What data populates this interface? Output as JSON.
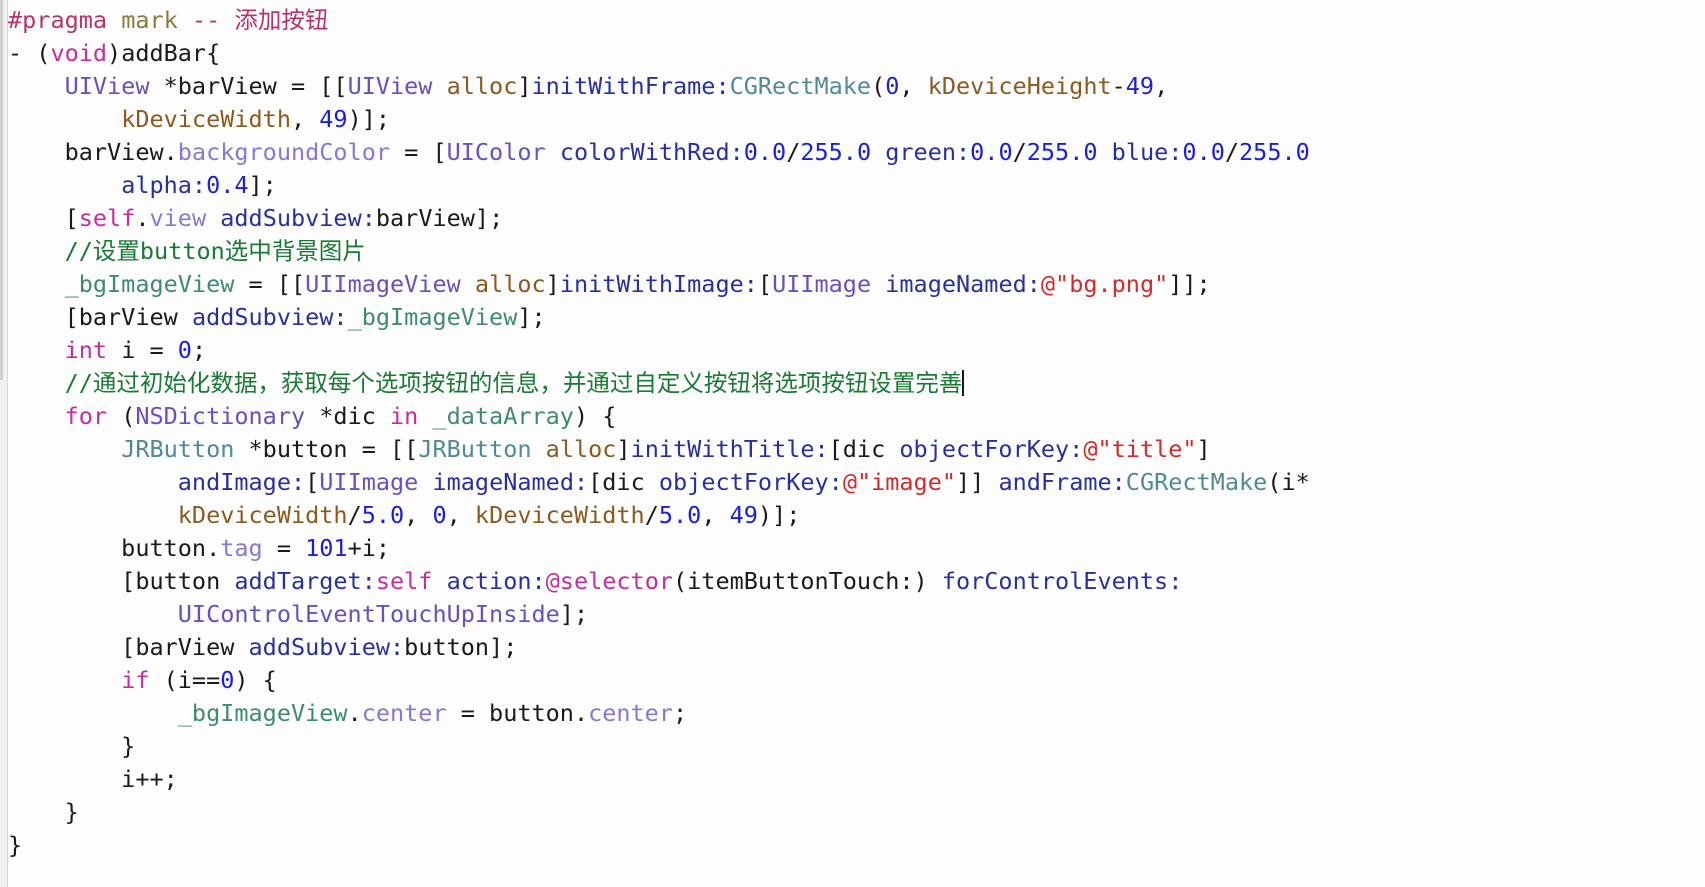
{
  "editor": {
    "language": "Objective-C",
    "background_color": "#ffffff",
    "gutter_color": "#f1f1f1",
    "font_size_px": 23.5,
    "caret_visible": true
  },
  "theme": {
    "plain": "#1a1a1a",
    "comment": "#1a7a35",
    "keyword": "#c42ea0",
    "class": "#6b4fbb",
    "custom_class": "#4f8a96",
    "property": "#8a78d0",
    "method": "#2a2f9e",
    "number": "#1d1ddb",
    "string": "#d12b2b",
    "constant": "#8a5a1e",
    "ivar": "#3f8a74",
    "preprocessor": "#b7336f"
  },
  "code_lines": [
    {
      "n": 1,
      "text": "#pragma mark -- 添加按钮",
      "tokens": [
        {
          "t": "#pragma",
          "c": "t-pre"
        },
        {
          "t": " ",
          "c": "t-plain"
        },
        {
          "t": "mark",
          "c": "t-preword"
        },
        {
          "t": " -- 添加按钮",
          "c": "t-pre"
        }
      ]
    },
    {
      "n": 2,
      "text": "- (void)addBar{",
      "tokens": [
        {
          "t": "- (",
          "c": "t-plain"
        },
        {
          "t": "void",
          "c": "t-keyword"
        },
        {
          "t": ")addBar{",
          "c": "t-plain"
        }
      ]
    },
    {
      "n": 3,
      "text": "    UIView *barView = [[UIView alloc]initWithFrame:CGRectMake(0, kDeviceHeight-49,",
      "tokens": [
        {
          "t": "    ",
          "c": "t-plain"
        },
        {
          "t": "UIView",
          "c": "t-class"
        },
        {
          "t": " *barView = [[",
          "c": "t-plain"
        },
        {
          "t": "UIView",
          "c": "t-class"
        },
        {
          "t": " ",
          "c": "t-plain"
        },
        {
          "t": "alloc",
          "c": "t-const"
        },
        {
          "t": "]",
          "c": "t-plain"
        },
        {
          "t": "initWithFrame:",
          "c": "t-method"
        },
        {
          "t": "CGRectMake",
          "c": "t-custom"
        },
        {
          "t": "(",
          "c": "t-plain"
        },
        {
          "t": "0",
          "c": "t-num"
        },
        {
          "t": ", ",
          "c": "t-plain"
        },
        {
          "t": "kDeviceHeight",
          "c": "t-const"
        },
        {
          "t": "-",
          "c": "t-plain"
        },
        {
          "t": "49",
          "c": "t-num"
        },
        {
          "t": ",",
          "c": "t-plain"
        }
      ]
    },
    {
      "n": 4,
      "text": "        kDeviceWidth, 49)];",
      "tokens": [
        {
          "t": "        ",
          "c": "t-plain"
        },
        {
          "t": "kDeviceWidth",
          "c": "t-const"
        },
        {
          "t": ", ",
          "c": "t-plain"
        },
        {
          "t": "49",
          "c": "t-num"
        },
        {
          "t": ")];",
          "c": "t-plain"
        }
      ]
    },
    {
      "n": 5,
      "text": "    barView.backgroundColor = [UIColor colorWithRed:0.0/255.0 green:0.0/255.0 blue:0.0/255.0",
      "tokens": [
        {
          "t": "    barView.",
          "c": "t-plain"
        },
        {
          "t": "backgroundColor",
          "c": "t-prop"
        },
        {
          "t": " = [",
          "c": "t-plain"
        },
        {
          "t": "UIColor",
          "c": "t-class"
        },
        {
          "t": " ",
          "c": "t-plain"
        },
        {
          "t": "colorWithRed:",
          "c": "t-method"
        },
        {
          "t": "0.0",
          "c": "t-num"
        },
        {
          "t": "/",
          "c": "t-plain"
        },
        {
          "t": "255.0",
          "c": "t-num"
        },
        {
          "t": " ",
          "c": "t-plain"
        },
        {
          "t": "green:",
          "c": "t-method"
        },
        {
          "t": "0.0",
          "c": "t-num"
        },
        {
          "t": "/",
          "c": "t-plain"
        },
        {
          "t": "255.0",
          "c": "t-num"
        },
        {
          "t": " ",
          "c": "t-plain"
        },
        {
          "t": "blue:",
          "c": "t-method"
        },
        {
          "t": "0.0",
          "c": "t-num"
        },
        {
          "t": "/",
          "c": "t-plain"
        },
        {
          "t": "255.0",
          "c": "t-num"
        }
      ]
    },
    {
      "n": 6,
      "text": "        alpha:0.4];",
      "tokens": [
        {
          "t": "        ",
          "c": "t-plain"
        },
        {
          "t": "alpha:",
          "c": "t-method"
        },
        {
          "t": "0.4",
          "c": "t-num"
        },
        {
          "t": "];",
          "c": "t-plain"
        }
      ]
    },
    {
      "n": 7,
      "text": "    [self.view addSubview:barView];",
      "tokens": [
        {
          "t": "    [",
          "c": "t-plain"
        },
        {
          "t": "self",
          "c": "t-keyword"
        },
        {
          "t": ".",
          "c": "t-plain"
        },
        {
          "t": "view",
          "c": "t-prop"
        },
        {
          "t": " ",
          "c": "t-plain"
        },
        {
          "t": "addSubview:",
          "c": "t-method"
        },
        {
          "t": "barView];",
          "c": "t-plain"
        }
      ]
    },
    {
      "n": 8,
      "text": "    //设置button选中背景图片",
      "tokens": [
        {
          "t": "    ",
          "c": "t-plain"
        },
        {
          "t": "//设置button选中背景图片",
          "c": "t-comment"
        }
      ]
    },
    {
      "n": 9,
      "text": "    _bgImageView = [[UIImageView alloc]initWithImage:[UIImage imageNamed:@\"bg.png\"]];",
      "tokens": [
        {
          "t": "    ",
          "c": "t-plain"
        },
        {
          "t": "_bgImageView",
          "c": "t-ivar"
        },
        {
          "t": " = [[",
          "c": "t-plain"
        },
        {
          "t": "UIImageView",
          "c": "t-class"
        },
        {
          "t": " ",
          "c": "t-plain"
        },
        {
          "t": "alloc",
          "c": "t-const"
        },
        {
          "t": "]",
          "c": "t-plain"
        },
        {
          "t": "initWithImage:",
          "c": "t-method"
        },
        {
          "t": "[",
          "c": "t-plain"
        },
        {
          "t": "UIImage",
          "c": "t-class"
        },
        {
          "t": " ",
          "c": "t-plain"
        },
        {
          "t": "imageNamed:",
          "c": "t-method"
        },
        {
          "t": "@\"bg.png\"",
          "c": "t-string"
        },
        {
          "t": "]];",
          "c": "t-plain"
        }
      ]
    },
    {
      "n": 10,
      "text": "    [barView addSubview:_bgImageView];",
      "tokens": [
        {
          "t": "    [barView ",
          "c": "t-plain"
        },
        {
          "t": "addSubview:",
          "c": "t-method"
        },
        {
          "t": "_bgImageView",
          "c": "t-ivar"
        },
        {
          "t": "];",
          "c": "t-plain"
        }
      ]
    },
    {
      "n": 11,
      "text": "    int i = 0;",
      "tokens": [
        {
          "t": "    ",
          "c": "t-plain"
        },
        {
          "t": "int",
          "c": "t-keyword"
        },
        {
          "t": " i = ",
          "c": "t-plain"
        },
        {
          "t": "0",
          "c": "t-num"
        },
        {
          "t": ";",
          "c": "t-plain"
        }
      ]
    },
    {
      "n": 12,
      "text": "    //通过初始化数据，获取每个选项按钮的信息，并通过自定义按钮将选项按钮设置完善",
      "has_caret": true,
      "tokens": [
        {
          "t": "    ",
          "c": "t-plain"
        },
        {
          "t": "//通过初始化数据，获取每个选项按钮的信息，并通过自定义按钮将选项按钮设置完善",
          "c": "t-comment"
        }
      ]
    },
    {
      "n": 13,
      "text": "    for (NSDictionary *dic in _dataArray) {",
      "tokens": [
        {
          "t": "    ",
          "c": "t-plain"
        },
        {
          "t": "for",
          "c": "t-keyword"
        },
        {
          "t": " (",
          "c": "t-plain"
        },
        {
          "t": "NSDictionary",
          "c": "t-class"
        },
        {
          "t": " *dic ",
          "c": "t-plain"
        },
        {
          "t": "in",
          "c": "t-keyword"
        },
        {
          "t": " ",
          "c": "t-plain"
        },
        {
          "t": "_dataArray",
          "c": "t-ivar"
        },
        {
          "t": ") {",
          "c": "t-plain"
        }
      ]
    },
    {
      "n": 14,
      "text": "        JRButton *button = [[JRButton alloc]initWithTitle:[dic objectForKey:@\"title\"]",
      "tokens": [
        {
          "t": "        ",
          "c": "t-plain"
        },
        {
          "t": "JRButton",
          "c": "t-custom"
        },
        {
          "t": " *button = [[",
          "c": "t-plain"
        },
        {
          "t": "JRButton",
          "c": "t-custom"
        },
        {
          "t": " ",
          "c": "t-plain"
        },
        {
          "t": "alloc",
          "c": "t-const"
        },
        {
          "t": "]",
          "c": "t-plain"
        },
        {
          "t": "initWithTitle:",
          "c": "t-method"
        },
        {
          "t": "[dic ",
          "c": "t-plain"
        },
        {
          "t": "objectForKey:",
          "c": "t-method"
        },
        {
          "t": "@\"title\"",
          "c": "t-string"
        },
        {
          "t": "]",
          "c": "t-plain"
        }
      ]
    },
    {
      "n": 15,
      "text": "            andImage:[UIImage imageNamed:[dic objectForKey:@\"image\"]] andFrame:CGRectMake(i*",
      "tokens": [
        {
          "t": "            ",
          "c": "t-plain"
        },
        {
          "t": "andImage:",
          "c": "t-method"
        },
        {
          "t": "[",
          "c": "t-plain"
        },
        {
          "t": "UIImage",
          "c": "t-class"
        },
        {
          "t": " ",
          "c": "t-plain"
        },
        {
          "t": "imageNamed:",
          "c": "t-method"
        },
        {
          "t": "[dic ",
          "c": "t-plain"
        },
        {
          "t": "objectForKey:",
          "c": "t-method"
        },
        {
          "t": "@\"image\"",
          "c": "t-string"
        },
        {
          "t": "]] ",
          "c": "t-plain"
        },
        {
          "t": "andFrame:",
          "c": "t-method"
        },
        {
          "t": "CGRectMake",
          "c": "t-custom"
        },
        {
          "t": "(i*",
          "c": "t-plain"
        }
      ]
    },
    {
      "n": 16,
      "text": "            kDeviceWidth/5.0, 0, kDeviceWidth/5.0, 49)];",
      "tokens": [
        {
          "t": "            ",
          "c": "t-plain"
        },
        {
          "t": "kDeviceWidth",
          "c": "t-const"
        },
        {
          "t": "/",
          "c": "t-plain"
        },
        {
          "t": "5.0",
          "c": "t-num"
        },
        {
          "t": ", ",
          "c": "t-plain"
        },
        {
          "t": "0",
          "c": "t-num"
        },
        {
          "t": ", ",
          "c": "t-plain"
        },
        {
          "t": "kDeviceWidth",
          "c": "t-const"
        },
        {
          "t": "/",
          "c": "t-plain"
        },
        {
          "t": "5.0",
          "c": "t-num"
        },
        {
          "t": ", ",
          "c": "t-plain"
        },
        {
          "t": "49",
          "c": "t-num"
        },
        {
          "t": ")];",
          "c": "t-plain"
        }
      ]
    },
    {
      "n": 17,
      "text": "        button.tag = 101+i;",
      "tokens": [
        {
          "t": "        button.",
          "c": "t-plain"
        },
        {
          "t": "tag",
          "c": "t-prop"
        },
        {
          "t": " = ",
          "c": "t-plain"
        },
        {
          "t": "101",
          "c": "t-num"
        },
        {
          "t": "+i;",
          "c": "t-plain"
        }
      ]
    },
    {
      "n": 18,
      "text": "        [button addTarget:self action:@selector(itemButtonTouch:) forControlEvents:",
      "tokens": [
        {
          "t": "        [button ",
          "c": "t-plain"
        },
        {
          "t": "addTarget:",
          "c": "t-method"
        },
        {
          "t": "self",
          "c": "t-keyword"
        },
        {
          "t": " ",
          "c": "t-plain"
        },
        {
          "t": "action:",
          "c": "t-method"
        },
        {
          "t": "@selector",
          "c": "t-keyword"
        },
        {
          "t": "(itemButtonTouch:) ",
          "c": "t-plain"
        },
        {
          "t": "forControlEvents:",
          "c": "t-method"
        }
      ]
    },
    {
      "n": 19,
      "text": "            UIControlEventTouchUpInside];",
      "tokens": [
        {
          "t": "            ",
          "c": "t-plain"
        },
        {
          "t": "UIControlEventTouchUpInside",
          "c": "t-class"
        },
        {
          "t": "];",
          "c": "t-plain"
        }
      ]
    },
    {
      "n": 20,
      "text": "        [barView addSubview:button];",
      "tokens": [
        {
          "t": "        [barView ",
          "c": "t-plain"
        },
        {
          "t": "addSubview:",
          "c": "t-method"
        },
        {
          "t": "button];",
          "c": "t-plain"
        }
      ]
    },
    {
      "n": 21,
      "text": "        if (i==0) {",
      "tokens": [
        {
          "t": "        ",
          "c": "t-plain"
        },
        {
          "t": "if",
          "c": "t-keyword"
        },
        {
          "t": " (i==",
          "c": "t-plain"
        },
        {
          "t": "0",
          "c": "t-num"
        },
        {
          "t": ") {",
          "c": "t-plain"
        }
      ]
    },
    {
      "n": 22,
      "text": "            _bgImageView.center = button.center;",
      "tokens": [
        {
          "t": "            ",
          "c": "t-plain"
        },
        {
          "t": "_bgImageView",
          "c": "t-ivar"
        },
        {
          "t": ".",
          "c": "t-plain"
        },
        {
          "t": "center",
          "c": "t-prop"
        },
        {
          "t": " = button.",
          "c": "t-plain"
        },
        {
          "t": "center",
          "c": "t-prop"
        },
        {
          "t": ";",
          "c": "t-plain"
        }
      ]
    },
    {
      "n": 23,
      "text": "        }",
      "tokens": [
        {
          "t": "        }",
          "c": "t-plain"
        }
      ]
    },
    {
      "n": 24,
      "text": "        i++;",
      "tokens": [
        {
          "t": "        i++;",
          "c": "t-plain"
        }
      ]
    },
    {
      "n": 25,
      "text": "    }",
      "tokens": [
        {
          "t": "    }",
          "c": "t-plain"
        }
      ]
    },
    {
      "n": 26,
      "text": "}",
      "tokens": [
        {
          "t": "}",
          "c": "t-plain"
        }
      ]
    }
  ]
}
